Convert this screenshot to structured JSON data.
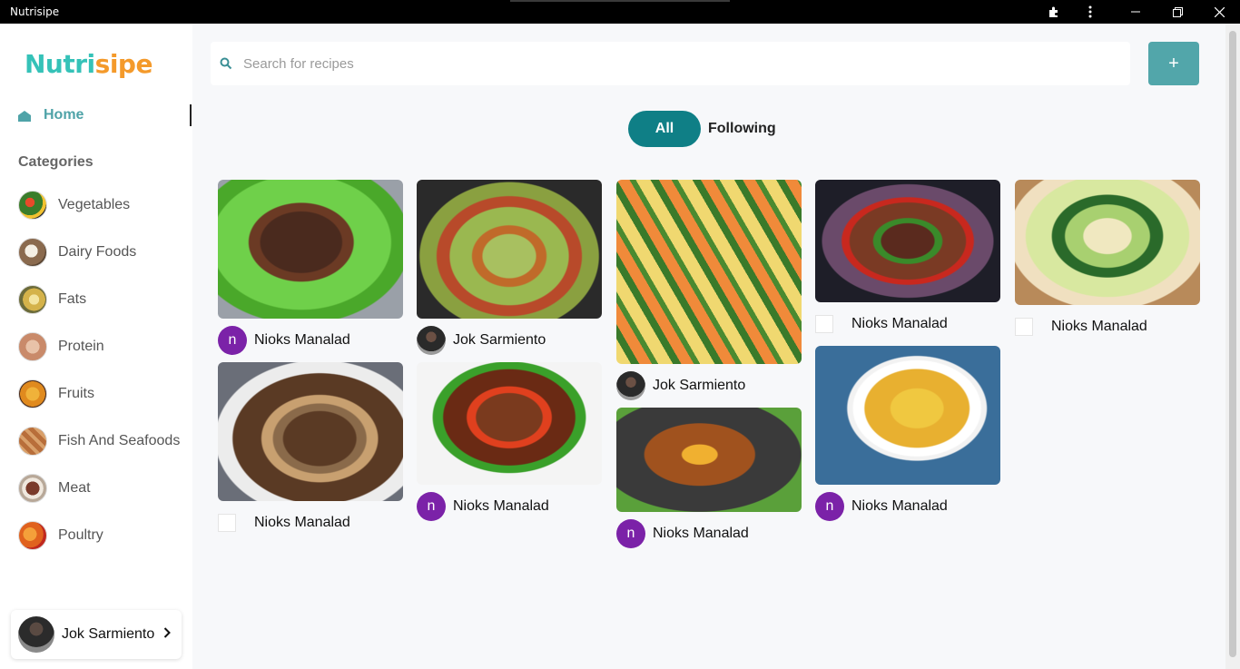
{
  "window": {
    "title": "Nutrisipe",
    "controls": [
      "extensions-icon",
      "more-icon",
      "minimize-icon",
      "restore-icon",
      "close-icon"
    ]
  },
  "sidebar": {
    "logo_part1": "Nutri",
    "logo_part2": "sipe",
    "home_label": "Home",
    "categories_heading": "Categories",
    "categories": [
      {
        "label": "Vegetables",
        "color": "#3a7d2b"
      },
      {
        "label": "Dairy Foods",
        "color": "#8a6a4e"
      },
      {
        "label": "Fats",
        "color": "#d4b24a"
      },
      {
        "label": "Protein",
        "color": "#c98a6a"
      },
      {
        "label": "Fruits",
        "color": "#e08a1e"
      },
      {
        "label": "Fish And Seafoods",
        "color": "#b86e3a"
      },
      {
        "label": "Meat",
        "color": "#7a3a2a"
      },
      {
        "label": "Poultry",
        "color": "#e0621e"
      }
    ],
    "profile": {
      "name": "Jok Sarmiento"
    }
  },
  "search": {
    "placeholder": "Search for recipes",
    "value": ""
  },
  "add_button_label": "+",
  "tabs": {
    "all": "All",
    "following": "Following",
    "active": "All"
  },
  "feed": [
    {
      "author": "Nioks Manalad",
      "avatar": "n",
      "avatar_type": "letter"
    },
    {
      "author": "Nioks Manalad",
      "avatar": "",
      "avatar_type": "broken"
    },
    {
      "author": "Jok Sarmiento",
      "avatar": "",
      "avatar_type": "photo"
    },
    {
      "author": "Nioks Manalad",
      "avatar": "n",
      "avatar_type": "letter"
    },
    {
      "author": "Jok Sarmiento",
      "avatar": "",
      "avatar_type": "photo"
    },
    {
      "author": "Nioks Manalad",
      "avatar": "n",
      "avatar_type": "letter"
    },
    {
      "author": "Nioks Manalad",
      "avatar": "",
      "avatar_type": "broken"
    },
    {
      "author": "Nioks Manalad",
      "avatar": "n",
      "avatar_type": "letter"
    },
    {
      "author": "Nioks Manalad",
      "avatar": "",
      "avatar_type": "broken"
    }
  ],
  "colors": {
    "accent": "#0f7f86",
    "add_button": "#52a6aa",
    "avatar_letter_bg": "#7b22a8",
    "logo_teal": "#35c2b8",
    "logo_orange": "#f49a2b"
  }
}
